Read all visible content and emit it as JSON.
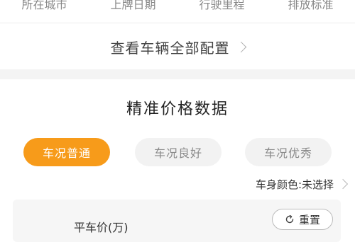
{
  "spec_tabs": [
    "所在城市",
    "上牌日期",
    "行驶里程",
    "排放标准"
  ],
  "config_link": {
    "label": "查看车辆全部配置",
    "icon": "chevron-right-icon"
  },
  "pricing": {
    "title": "精准价格数据",
    "conditions": [
      {
        "label": "车况普通",
        "active": true
      },
      {
        "label": "车况良好",
        "active": false
      },
      {
        "label": "车况优秀",
        "active": false
      }
    ],
    "color_select": {
      "label": "车身颜色:未选择",
      "icon": "chevron-right-icon"
    },
    "card": {
      "price_label": "平车价(万)",
      "reset_label": "重置",
      "reset_icon": "refresh-icon"
    }
  },
  "colors": {
    "accent": "#f79b1a",
    "pill_bg": "#f2f2f2",
    "band": "#f4f4f4"
  }
}
